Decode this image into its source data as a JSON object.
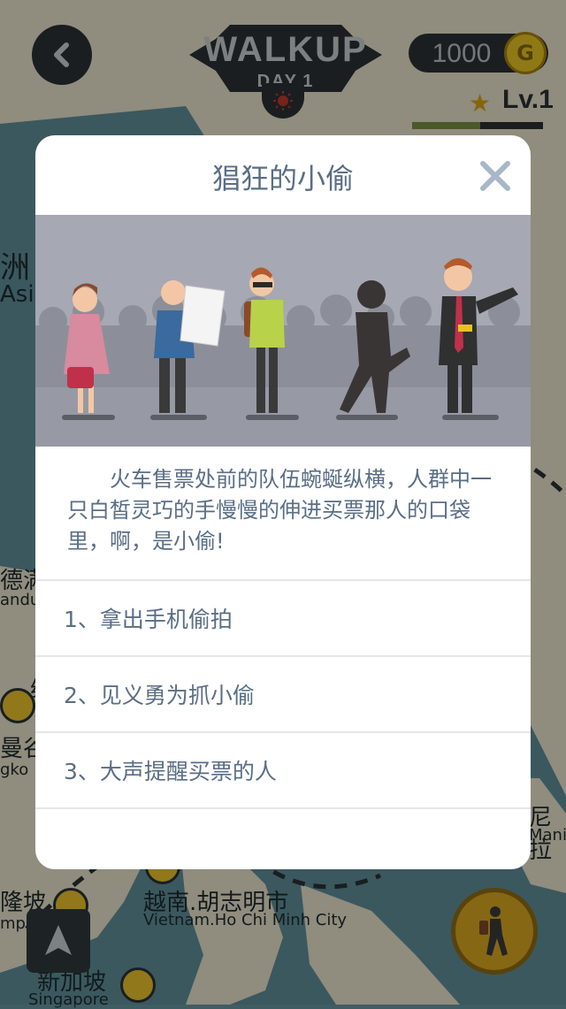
{
  "header": {
    "logo_title": "WALKUP",
    "logo_day": "DAY.1",
    "coins": "1000",
    "coin_symbol": "G",
    "level": "Lv.1",
    "xp_progress": 0.52
  },
  "map": {
    "labels": [
      {
        "text": "洲",
        "cls": "big"
      },
      {
        "text": "Asia",
        "cls": "sub"
      },
      {
        "text": "德满",
        "cls": "big"
      },
      {
        "text": "andu",
        "cls": "sub"
      },
      {
        "text": "缅",
        "cls": "big"
      },
      {
        "text": "曼谷",
        "cls": "big"
      },
      {
        "text": "gko",
        "cls": "sub"
      },
      {
        "text": "尼拉",
        "cls": "big"
      },
      {
        "text": "Manil",
        "cls": "sub"
      },
      {
        "text": "隆坡",
        "cls": "big"
      },
      {
        "text": "mpur",
        "cls": "sub"
      },
      {
        "text": "越南.胡志明市",
        "cls": "big"
      },
      {
        "text": "Vietnam.Ho Chi Minh City",
        "cls": "sub"
      },
      {
        "text": "新加坡",
        "cls": "big"
      },
      {
        "text": "Singapore",
        "cls": "sub"
      }
    ]
  },
  "dialog": {
    "title": "猖狂的小偷",
    "story": "火车售票处前的队伍蜿蜒纵横，人群中一只白皙灵巧的手慢慢的伸进买票那人的口袋里，啊，是小偷!",
    "options": [
      {
        "label": "1、拿出手机偷拍"
      },
      {
        "label": "2、见义勇为抓小偷"
      },
      {
        "label": "3、大声提醒买票的人"
      }
    ]
  },
  "colors": {
    "dialog_text": "#5a6e86",
    "coin_gold": "#e7c326",
    "map_sea": "#5f8f99",
    "map_land": "#e9e3cc"
  }
}
